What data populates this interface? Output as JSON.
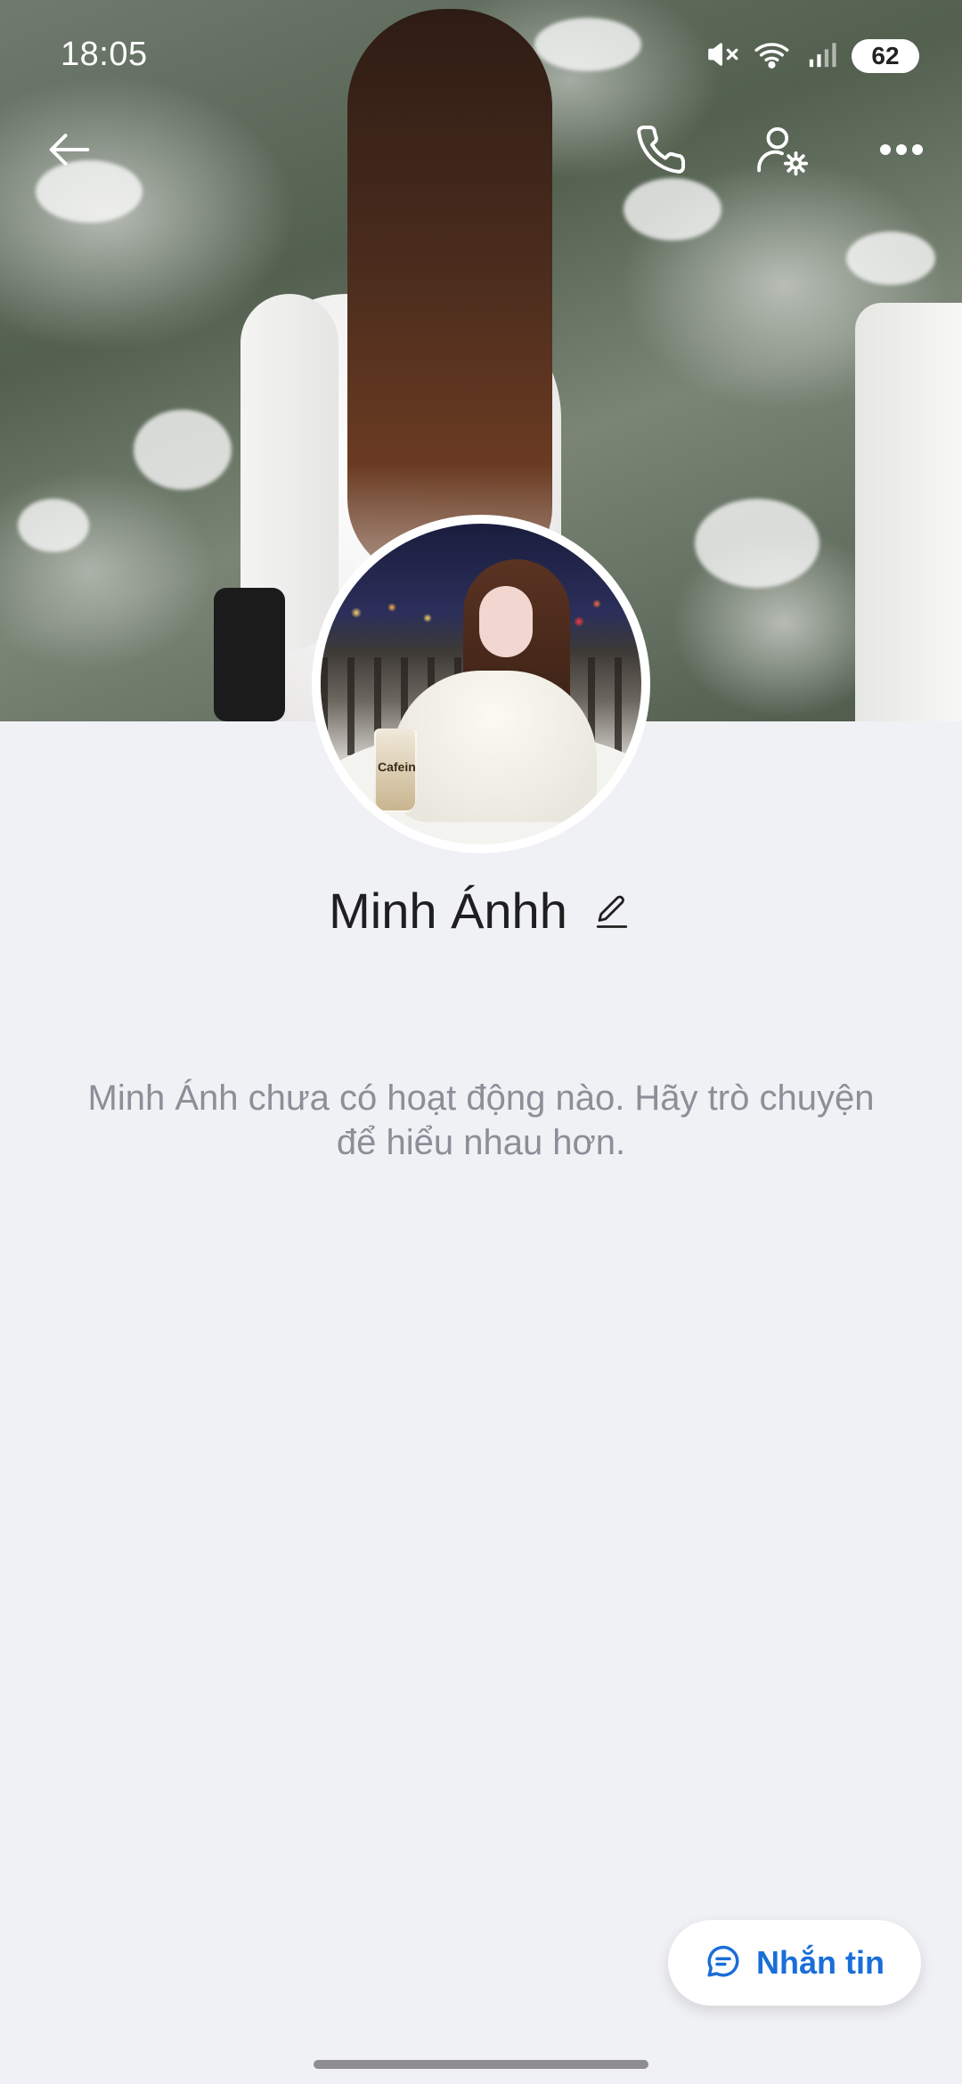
{
  "status_bar": {
    "time": "18:05",
    "battery": "62",
    "icons": [
      "mute-icon",
      "wifi-icon",
      "signal-icon"
    ]
  },
  "nav": {
    "icons": [
      "back-arrow-icon",
      "phone-icon",
      "user-settings-icon",
      "more-icon"
    ]
  },
  "profile": {
    "name": "Minh Ánhh",
    "avatar_cup_text": "Cafein"
  },
  "empty_state": {
    "message": "Minh Ánh chưa có hoạt động nào. Hãy trò chuyện để hiểu nhau hơn."
  },
  "message_button": {
    "label": "Nhắn tin",
    "icon": "chat-bubble-icon"
  },
  "colors": {
    "accent": "#1a6ed8",
    "background": "#f0f1f5",
    "muted_text": "#8a8f98",
    "name_text": "#1f1f1f"
  }
}
